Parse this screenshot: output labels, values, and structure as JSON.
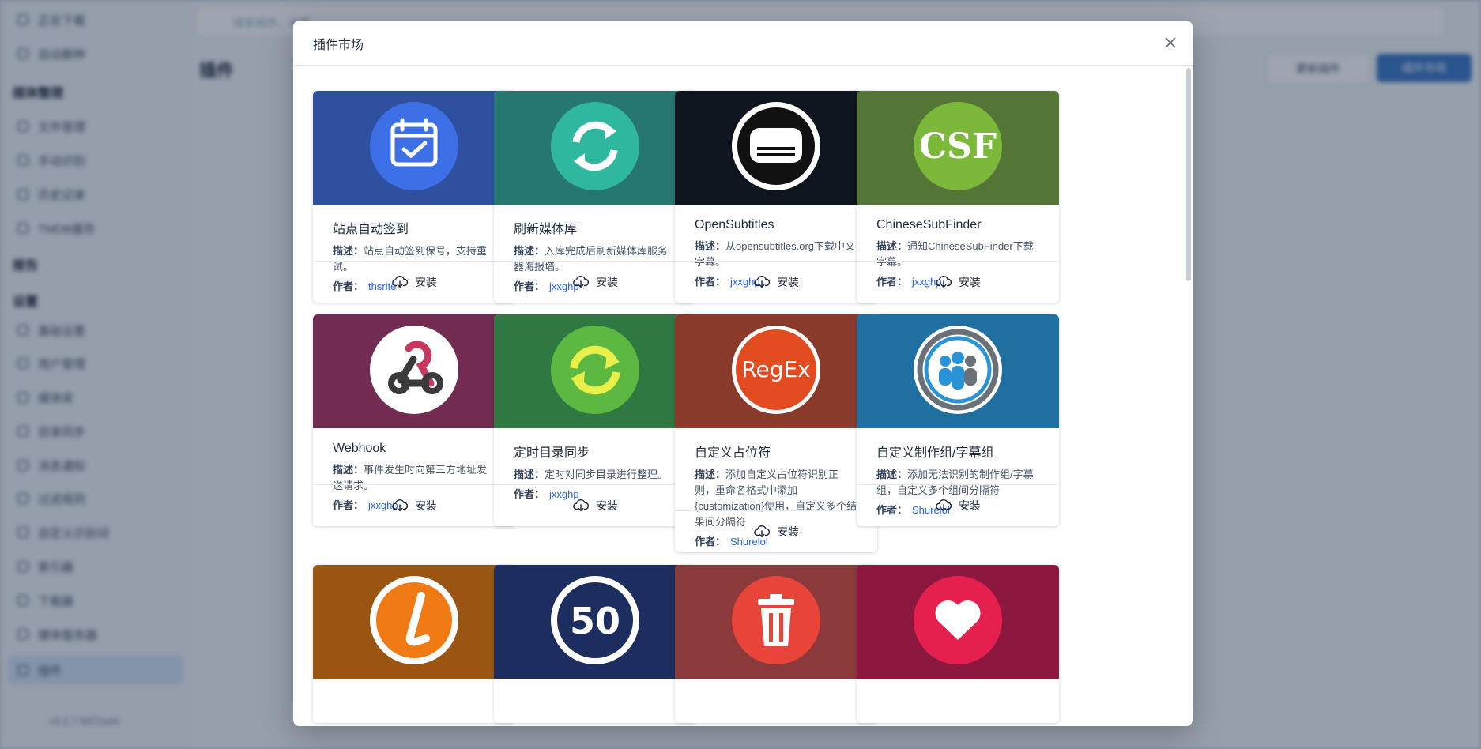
{
  "background": {
    "search_placeholder": "搜索插件、设置 ...",
    "page_title": "插件",
    "header_buttons": [
      "更新插件",
      "插件市场"
    ],
    "sidebar_groups": [
      "媒体整理",
      "报告",
      "设置"
    ],
    "sidebar_items": [
      "正在下载",
      "自动删种",
      "文件管理",
      "手动识别",
      "历史记录",
      "TMDB缓存",
      "基础设置",
      "用户管理",
      "媒体库",
      "目录同步",
      "消息通知",
      "过滤规则",
      "自定义识别词",
      "索引器",
      "下载器",
      "媒体服务器",
      "插件"
    ],
    "version": "v3.2.7 9d72a4e"
  },
  "dialog": {
    "title": "插件市场",
    "desc_label": "描述：",
    "author_label": "作者：",
    "install_label": "安装",
    "colors": {
      "accent": "#2563eb"
    }
  },
  "plugins": [
    {
      "name": "站点自动签到",
      "desc": "站点自动签到保号，支持重试。",
      "author": "thsrite",
      "bg": "#2f4f9f",
      "icon": "calendar-check-icon"
    },
    {
      "name": "刷新媒体库",
      "desc": "入库完成后刷新媒体库服务器海报墙。",
      "author": "jxxghp",
      "bg": "#26776f",
      "icon": "refresh-icon"
    },
    {
      "name": "OpenSubtitles",
      "desc": "从opensubtitles.org下载中文字幕。",
      "author": "jxxghp",
      "bg": "#0f151e",
      "icon": "subtitles-icon"
    },
    {
      "name": "ChineseSubFinder",
      "desc": "通知ChineseSubFinder下载字幕。",
      "author": "jxxghp",
      "bg": "#537636",
      "icon": "csf-icon"
    },
    {
      "name": "Webhook",
      "desc": "事件发生时向第三方地址发送请求。",
      "author": "jxxghp",
      "bg": "#722b51",
      "icon": "webhook-icon"
    },
    {
      "name": "定时目录同步",
      "desc": "定时对同步目录进行整理。",
      "author": "jxxghp",
      "bg": "#2f7841",
      "icon": "sync-icon"
    },
    {
      "name": "自定义占位符",
      "desc": "添加自定义占位符识别正则，重命名格式中添加{customization}使用，自定义多个结果间分隔符",
      "author": "Shurelol",
      "bg": "#8a3a2a",
      "icon": "regex-icon"
    },
    {
      "name": "自定义制作组/字幕组",
      "desc": "添加无法识别的制作组/字幕组，自定义多个组间分隔符",
      "author": "Shurelol",
      "bg": "#1f6fa0",
      "icon": "group-icon"
    },
    {
      "bg": "#9a5512",
      "icon": "torrent-client-icon"
    },
    {
      "bg": "#1d2d5f",
      "icon": "speed-limit-icon"
    },
    {
      "bg": "#8a3a3a",
      "icon": "trash-icon"
    },
    {
      "bg": "#8c1840",
      "icon": "heart-icon"
    }
  ]
}
